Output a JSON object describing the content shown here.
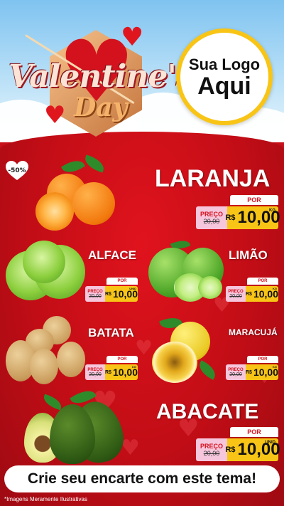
{
  "header": {
    "title_line1": "Valentine's",
    "title_line2": "Day",
    "logo_line1": "Sua Logo",
    "logo_line2": "Aqui"
  },
  "badge": {
    "text": "-50%"
  },
  "products": {
    "laranja": {
      "name": "LARANJA",
      "por": "POR",
      "preco": "PREÇO",
      "de": "de",
      "old": "20,00",
      "rs": "R$",
      "price": "10,00",
      "unit": "KG"
    },
    "alface": {
      "name": "ALFACE",
      "por": "POR",
      "preco": "PREÇO",
      "de": "de",
      "old": "20,00",
      "rs": "R$",
      "price": "10,00",
      "unit": "UNID"
    },
    "limao": {
      "name": "LIMÃO",
      "por": "POR",
      "preco": "PREÇO",
      "de": "de",
      "old": "20,00",
      "rs": "R$",
      "price": "10,00",
      "unit": "KG"
    },
    "batata": {
      "name": "BATATA",
      "por": "POR",
      "preco": "PREÇO",
      "de": "de",
      "old": "20,00",
      "rs": "R$",
      "price": "10,00",
      "unit": "KG"
    },
    "maracuja": {
      "name": "MARACUJÁ",
      "por": "POR",
      "preco": "PREÇO",
      "de": "de",
      "old": "20,00",
      "rs": "R$",
      "price": "10,00",
      "unit": "KG"
    },
    "abacate": {
      "name": "ABACATE",
      "por": "POR",
      "preco": "PREÇO",
      "de": "de",
      "old": "20,00",
      "rs": "R$",
      "price": "10,00",
      "unit": "UNID"
    }
  },
  "cta": {
    "text": "Crie seu encarte com este tema!"
  },
  "footnote": {
    "text": "*Imagens Meramente Ilustrativas"
  },
  "colors": {
    "red": "#c8101a",
    "yellow": "#f8c516",
    "pink": "#f6c6dc",
    "sky": "#7fc3f0"
  }
}
